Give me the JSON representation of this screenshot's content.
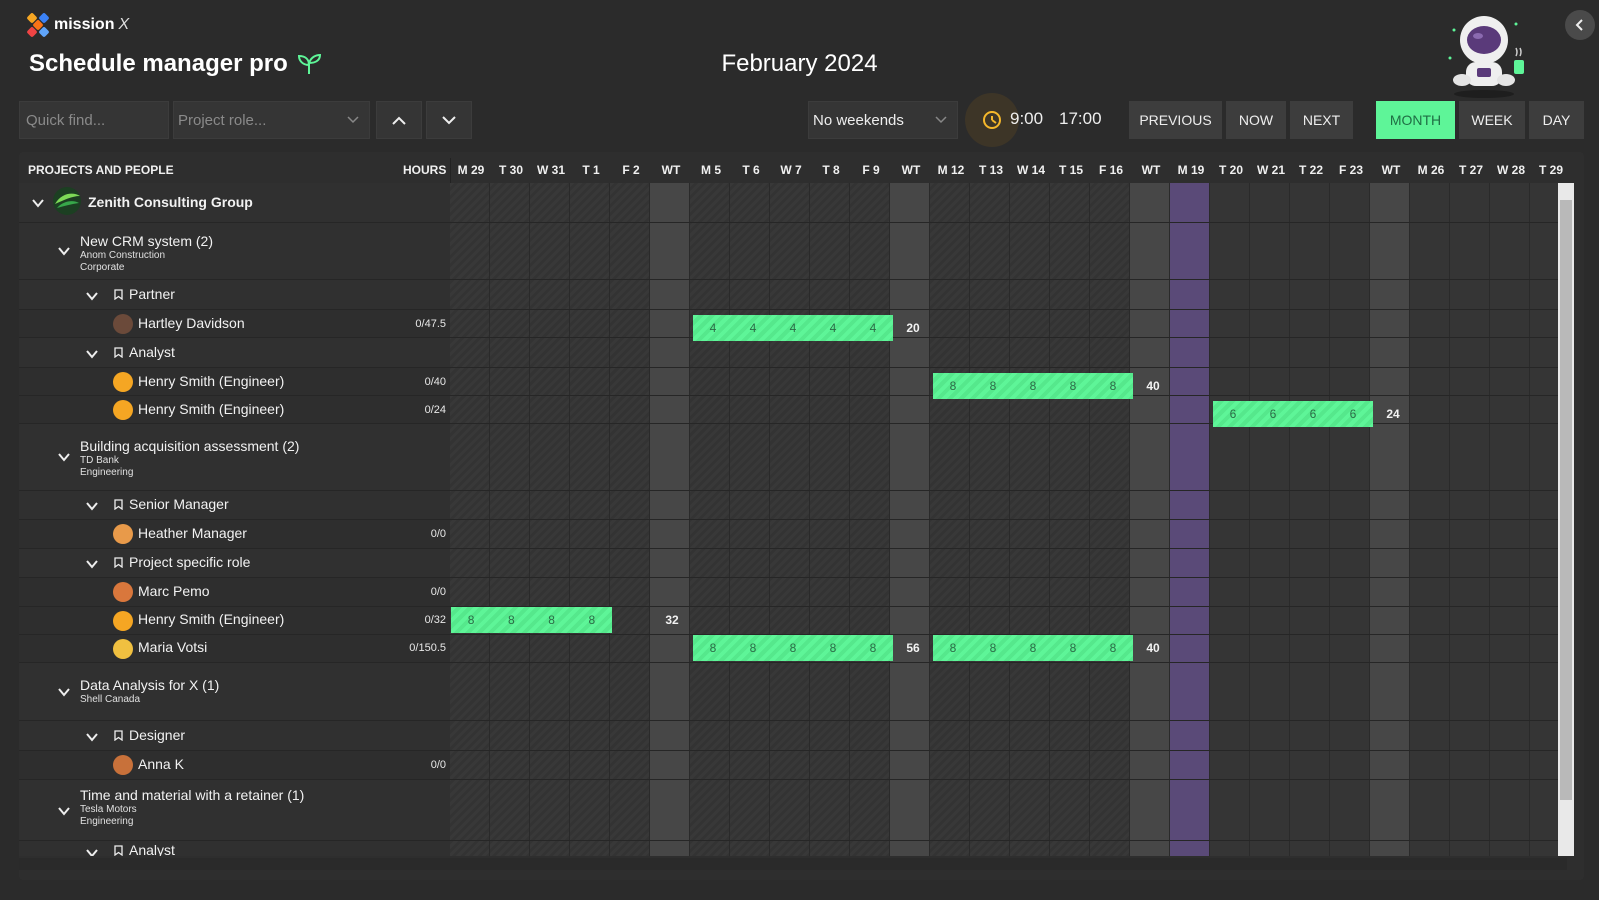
{
  "brand": {
    "name": "mission",
    "suffix": "X"
  },
  "app_title": "Schedule manager pro",
  "month_title": "February 2024",
  "toolbar": {
    "quick_find_placeholder": "Quick find...",
    "project_role_placeholder": "Project role...",
    "weekend_option": "No weekends",
    "start_time": "9:00",
    "end_time": "17:00",
    "previous": "PREVIOUS",
    "now": "NOW",
    "next": "NEXT",
    "views": [
      "MONTH",
      "WEEK",
      "DAY"
    ],
    "active_view": "MONTH"
  },
  "grid_headers": {
    "projects": "PROJECTS AND PEOPLE",
    "hours": "HOURS"
  },
  "days": [
    "M 29",
    "T 30",
    "W 31",
    "T 1",
    "F 2",
    "WT",
    "M 5",
    "T 6",
    "W 7",
    "T 8",
    "F 9",
    "WT",
    "M 12",
    "T 13",
    "W 14",
    "T 15",
    "F 16",
    "WT",
    "M 19",
    "T 20",
    "W 21",
    "T 22",
    "F 23",
    "WT",
    "M 26",
    "T 27",
    "W 28",
    "T 29"
  ],
  "company": {
    "name": "Zenith Consulting Group"
  },
  "rows": {
    "p1": {
      "title": "New CRM system (2)",
      "client": "Anom Construction",
      "category": "Corporate"
    },
    "r1": {
      "title": "Partner"
    },
    "u1": {
      "name": "Hartley Davidson",
      "hours": "0/47.5",
      "values": [
        "4",
        "4",
        "4",
        "4",
        "4"
      ],
      "total": "20"
    },
    "r2": {
      "title": "Analyst"
    },
    "u2": {
      "name": "Henry Smith (Engineer)",
      "hours": "0/40",
      "values": [
        "8",
        "8",
        "8",
        "8",
        "8"
      ],
      "total": "40"
    },
    "u3": {
      "name": "Henry Smith (Engineer)",
      "hours": "0/24",
      "values": [
        "6",
        "6",
        "6",
        "6"
      ],
      "total": "24"
    },
    "p2": {
      "title": "Building acquisition assessment (2)",
      "client": "TD Bank",
      "category": "Engineering"
    },
    "r3": {
      "title": "Senior Manager"
    },
    "u4": {
      "name": "Heather Manager",
      "hours": "0/0"
    },
    "r4": {
      "title": "Project specific role"
    },
    "u5": {
      "name": "Marc Pemo",
      "hours": "0/0"
    },
    "u6": {
      "name": "Henry Smith (Engineer)",
      "hours": "0/32",
      "values": [
        "8",
        "8",
        "8",
        "8"
      ],
      "total": "32"
    },
    "u7": {
      "name": "Maria Votsi",
      "hours": "0/150.5",
      "values_a": [
        "8",
        "8",
        "8",
        "8",
        "8"
      ],
      "total_a": "56",
      "values_b": [
        "8",
        "8",
        "8",
        "8",
        "8"
      ],
      "total_b": "40"
    },
    "p3": {
      "title": "Data Analysis for X (1)",
      "client": "Shell Canada"
    },
    "r5": {
      "title": "Designer"
    },
    "u8": {
      "name": "Anna K",
      "hours": "0/0"
    },
    "p4": {
      "title": "Time and material with a retainer (1)",
      "client": "Tesla Motors",
      "category": "Engineering"
    },
    "r6": {
      "title": "Analyst"
    }
  },
  "colors": {
    "accent": "#5ef598",
    "highlight_day": "#5a4a78",
    "background": "#2b2b2b"
  },
  "icons": [
    "mission-x-logo-icon",
    "sprout-icon",
    "astronaut-mascot-icon",
    "chevron-left-icon",
    "chevron-up-icon",
    "chevron-down-icon",
    "clock-icon",
    "bookmark-icon"
  ]
}
